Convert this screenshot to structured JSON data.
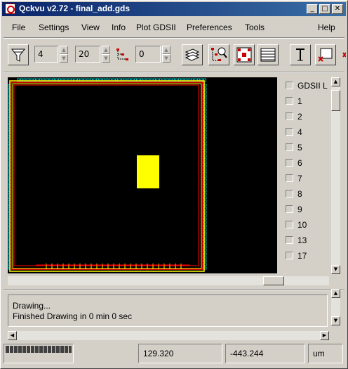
{
  "window": {
    "title": "Qckvu v2.72 - final_add.gds"
  },
  "menu": [
    "File",
    "Settings",
    "View",
    "Info",
    "Plot GDSII",
    "Preferences",
    "Tools",
    "Help"
  ],
  "toolbar": {
    "spin1_value": "4",
    "spin2_value": "20",
    "spin3_value": "0"
  },
  "layers": {
    "header": "GDSII L",
    "items": [
      "1",
      "2",
      "4",
      "5",
      "6",
      "7",
      "8",
      "9",
      "10",
      "13",
      "17"
    ]
  },
  "console": {
    "lines": [
      "Drawing...",
      "Finished Drawing in 0 min 0 sec"
    ]
  },
  "status": {
    "x": "129.320",
    "y": "-443.244",
    "units": "um"
  },
  "colors": {
    "title_start": "#0a246a",
    "chip_outline": "#ffff00",
    "pad_ring": "#ff0000",
    "pads": "#00c0c0",
    "block": "#ffff00",
    "canvas_bg": "#000000"
  }
}
